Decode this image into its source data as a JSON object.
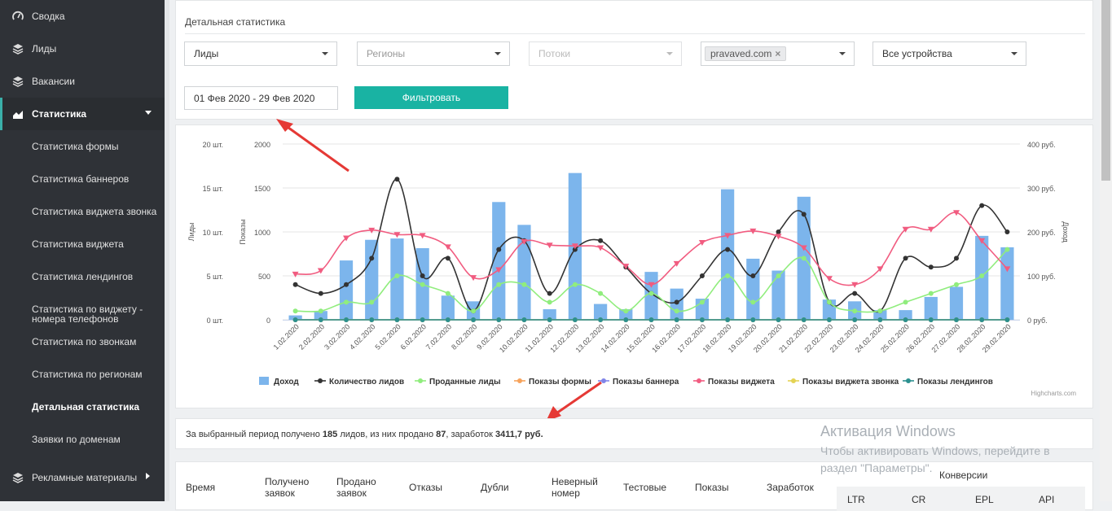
{
  "sidebar": {
    "items": [
      {
        "label": "Сводка",
        "icon": "speedometer-icon"
      },
      {
        "label": "Лиды",
        "icon": "layers-icon"
      },
      {
        "label": "Вакансии",
        "icon": "layers-icon"
      },
      {
        "label": "Статистика",
        "icon": "area-chart-icon"
      }
    ],
    "sub_items": [
      "Статистика формы",
      "Статистика баннеров",
      "Статистика виджета звонка",
      "Статистика виджета",
      "Статистика лендингов",
      "Статистика по виджету - номера телефонов",
      "Статистика по звонкам",
      "Статистика по регионам",
      "Детальная статистика",
      "Заявки по доменам"
    ],
    "bottom_item": {
      "label": "Рекламные материалы",
      "icon": "layers-icon"
    }
  },
  "filters": {
    "title": "Детальная статистика",
    "type_select": "Лиды",
    "region_placeholder": "Регионы",
    "flows_placeholder": "Потоки",
    "domain_tag": "pravaved.com",
    "devices_select": "Все устройства",
    "date_range": "01 Фев 2020 - 29 Фев 2020",
    "filter_button": "Фильтровать"
  },
  "chart_data": {
    "type": "bar",
    "categories": [
      "1.02.2020",
      "2.02.2020",
      "3.02.2020",
      "4.02.2020",
      "5.02.2020",
      "6.02.2020",
      "7.02.2020",
      "8.02.2020",
      "9.02.2020",
      "10.02.2020",
      "11.02.2020",
      "12.02.2020",
      "13.02.2020",
      "14.02.2020",
      "15.02.2020",
      "16.02.2020",
      "17.02.2020",
      "18.02.2020",
      "19.02.2020",
      "20.02.2020",
      "21.02.2020",
      "22.02.2020",
      "23.02.2020",
      "24.02.2020",
      "25.02.2020",
      "26.02.2020",
      "27.02.2020",
      "28.02.2020",
      "29.02.2020"
    ],
    "axes": {
      "leads": {
        "label": "Лиды",
        "ticks": [
          "0 шт.",
          "5 шт.",
          "10 шт.",
          "15 шт.",
          "20 шт."
        ],
        "range": [
          0,
          20
        ]
      },
      "views": {
        "label": "Показы",
        "ticks": [
          "0",
          "500",
          "1000",
          "1500",
          "2000"
        ],
        "range": [
          0,
          2000
        ]
      },
      "income": {
        "label": "Доход",
        "ticks": [
          "0 руб.",
          "100 руб.",
          "200 руб.",
          "300 руб.",
          "400 руб."
        ],
        "range": [
          0,
          400
        ]
      }
    },
    "series": [
      {
        "name": "Доход",
        "type": "bar",
        "axis": "income",
        "color": "#7cb5ec",
        "values": [
          10,
          20,
          135,
          182,
          185,
          163,
          55,
          42,
          268,
          216,
          24,
          334,
          36,
          24,
          109,
          71,
          48,
          297,
          139,
          112,
          280,
          46,
          42,
          22,
          22,
          52,
          75,
          191,
          165
        ]
      },
      {
        "name": "Количество лидов",
        "type": "line",
        "axis": "leads",
        "color": "#333333",
        "values": [
          4,
          3,
          4,
          7,
          16,
          5,
          7,
          1,
          8,
          9,
          3,
          8,
          9,
          6,
          3,
          2,
          5,
          8,
          5,
          10,
          12,
          2,
          3,
          1,
          7,
          6,
          7,
          13,
          10
        ]
      },
      {
        "name": "Проданные лиды",
        "type": "line",
        "axis": "leads",
        "color": "#90ed7d",
        "values": [
          1,
          1,
          2,
          2,
          5,
          4,
          3,
          1,
          4,
          4,
          2,
          4,
          3,
          1,
          3,
          1,
          2,
          5,
          2,
          5,
          7,
          2,
          1,
          1,
          2,
          3,
          4,
          5,
          8
        ]
      },
      {
        "name": "Показы формы",
        "type": "line",
        "axis": "views",
        "color": "#f7a35c",
        "values": [
          0,
          0,
          0,
          0,
          0,
          0,
          0,
          0,
          0,
          0,
          0,
          0,
          0,
          0,
          0,
          0,
          0,
          0,
          0,
          0,
          0,
          0,
          0,
          0,
          0,
          0,
          0,
          0,
          0
        ]
      },
      {
        "name": "Показы баннера",
        "type": "line",
        "axis": "views",
        "color": "#8085e9",
        "values": [
          0,
          0,
          0,
          0,
          0,
          0,
          0,
          0,
          0,
          0,
          0,
          0,
          0,
          0,
          0,
          0,
          0,
          0,
          0,
          0,
          0,
          0,
          0,
          0,
          0,
          0,
          0,
          0,
          0
        ]
      },
      {
        "name": "Показы виджета",
        "type": "line",
        "axis": "views",
        "color": "#f15c80",
        "values": [
          520,
          560,
          930,
          1020,
          970,
          960,
          830,
          480,
          570,
          890,
          850,
          840,
          820,
          610,
          400,
          640,
          880,
          960,
          1010,
          950,
          820,
          470,
          400,
          580,
          1030,
          1030,
          1220,
          900,
          580
        ]
      },
      {
        "name": "Показы виджета звонка",
        "type": "line",
        "axis": "views",
        "color": "#e4d354",
        "values": [
          0,
          0,
          0,
          0,
          0,
          0,
          0,
          0,
          0,
          0,
          0,
          0,
          0,
          0,
          0,
          0,
          0,
          0,
          0,
          0,
          0,
          0,
          0,
          0,
          0,
          0,
          0,
          0,
          0
        ]
      },
      {
        "name": "Показы лендингов",
        "type": "line",
        "axis": "views",
        "color": "#2b908f",
        "values": [
          0,
          0,
          0,
          0,
          0,
          0,
          0,
          0,
          0,
          0,
          0,
          0,
          0,
          0,
          0,
          0,
          0,
          0,
          0,
          0,
          0,
          0,
          0,
          0,
          0,
          0,
          0,
          0,
          0
        ]
      }
    ],
    "credits": "Highcharts.com"
  },
  "summary": {
    "prefix": "За выбранный период получено",
    "leads": "185",
    "mid1": "лидов, из них продано",
    "sold": "87",
    "mid2": ", заработок",
    "earned": "3411,7 руб."
  },
  "table": {
    "headers": [
      "Время",
      "Получено заявок",
      "Продано заявок",
      "Отказы",
      "Дубли",
      "Неверный номер",
      "Тестовые",
      "Показы",
      "Заработок"
    ],
    "conversions_label": "Конверсии",
    "conversion_cols": [
      "LTR",
      "CR",
      "EPL",
      "API"
    ]
  },
  "watermark": {
    "title": "Активация Windows",
    "text": "Чтобы активировать Windows, перейдите в раздел \"Параметры\"."
  }
}
